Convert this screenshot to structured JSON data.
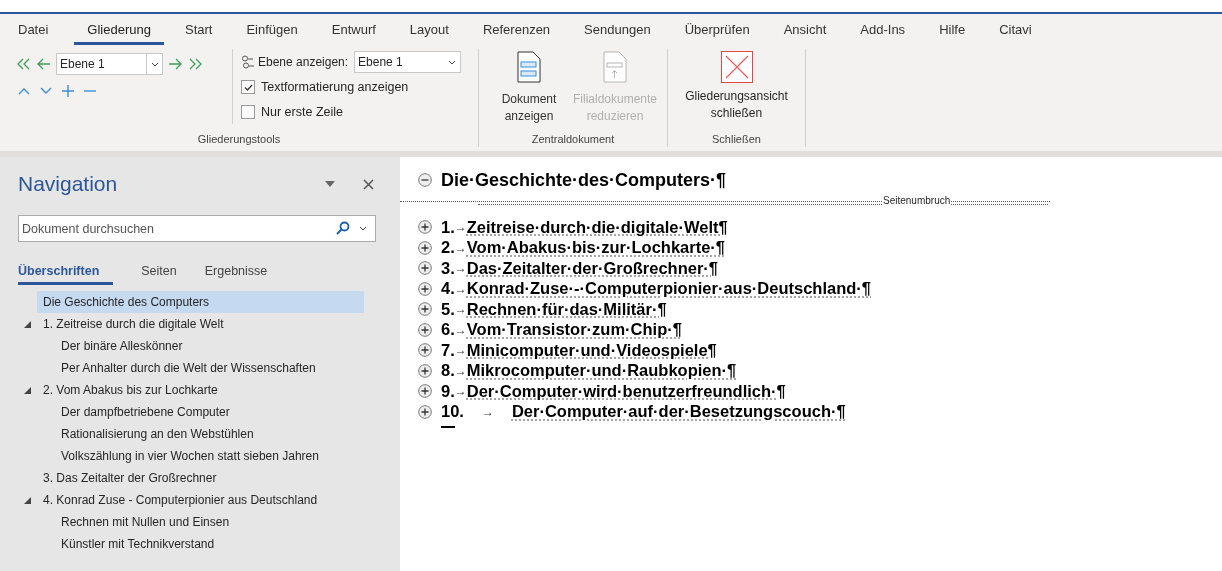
{
  "ribbon_tabs": [
    {
      "label": "Datei",
      "selected": false
    },
    {
      "label": "Gliederung",
      "selected": true
    },
    {
      "label": "Start",
      "selected": false
    },
    {
      "label": "Einfügen",
      "selected": false
    },
    {
      "label": "Entwurf",
      "selected": false
    },
    {
      "label": "Layout",
      "selected": false
    },
    {
      "label": "Referenzen",
      "selected": false
    },
    {
      "label": "Sendungen",
      "selected": false
    },
    {
      "label": "Überprüfen",
      "selected": false
    },
    {
      "label": "Ansicht",
      "selected": false
    },
    {
      "label": "Add-Ins",
      "selected": false
    },
    {
      "label": "Hilfe",
      "selected": false
    },
    {
      "label": "Citavi",
      "selected": false
    }
  ],
  "outline_tools": {
    "level_select": "Ebene 1",
    "show_level_label": "Ebene anzeigen:",
    "show_level_value": "Ebene 1",
    "checkboxes": [
      {
        "label": "Textformatierung anzeigen",
        "checked": true
      },
      {
        "label": "Nur erste Zeile",
        "checked": false
      }
    ],
    "group_label": "Gliederungstools"
  },
  "master_document": {
    "buttons": [
      {
        "label": "Dokument anzeigen",
        "disabled": false
      },
      {
        "label": "Filialdokumente reduzieren",
        "disabled": true
      }
    ],
    "group_label": "Zentraldokument"
  },
  "close_group": {
    "button": "Gliederungsansicht schließen",
    "group_label": "Schließen"
  },
  "navigation": {
    "title": "Navigation",
    "search": {
      "placeholder": "Dokument durchsuchen"
    },
    "tabs": [
      {
        "label": "Überschriften",
        "selected": true
      },
      {
        "label": "Seiten",
        "selected": false
      },
      {
        "label": "Ergebnisse",
        "selected": false
      }
    ],
    "headings": [
      {
        "label": "Die Geschichte des Computers",
        "selected": true
      },
      {
        "label": "1. Zeitreise durch die digitale Welt",
        "selected": false,
        "children": [
          {
            "label": "Der binäre Alleskönner",
            "selected": false
          },
          {
            "label": "Per Anhalter durch die Welt der Wissenschaften",
            "selected": false
          }
        ]
      },
      {
        "label": "2. Vom Abakus bis zur Lochkarte",
        "selected": false,
        "children": [
          {
            "label": "Der dampfbetriebene Computer",
            "selected": false
          },
          {
            "label": "Rationalisierung an den Webstühlen",
            "selected": false
          },
          {
            "label": "Volkszählung in vier Wochen statt sieben Jahren",
            "selected": false
          }
        ]
      },
      {
        "label": "3. Das Zeitalter der Großrechner",
        "selected": false
      },
      {
        "label": "4. Konrad Zuse - Computerpionier aus Deutschland",
        "selected": false,
        "children": [
          {
            "label": "Rechnen mit Nullen und Einsen",
            "selected": false
          },
          {
            "label": "Künstler mit Technikverstand",
            "selected": false
          }
        ]
      }
    ]
  },
  "document": {
    "title": {
      "text": "Die·Geschichte·des·Computers·¶",
      "has_subtext": false
    },
    "page_break_label": "Seitenumbruch",
    "chapters": [
      {
        "number": "1.",
        "tab_mark": "→",
        "text": "Zeitreise·durch·die·digitale·Welt¶",
        "has_subtext": true
      },
      {
        "number": "2.",
        "tab_mark": "→",
        "text": "Vom·Abakus·bis·zur·Lochkarte·¶",
        "has_subtext": true
      },
      {
        "number": "3.",
        "tab_mark": "→",
        "text": "Das·Zeitalter·der·Großrechner·¶",
        "has_subtext": true
      },
      {
        "number": "4.",
        "tab_mark": "→",
        "text": "Konrad·Zuse·-·Computerpionier·aus·Deutschland·¶",
        "has_subtext": true
      },
      {
        "number": "5.",
        "tab_mark": "→",
        "text": "Rechnen·für·das·Militär·¶",
        "has_subtext": true
      },
      {
        "number": "6.",
        "tab_mark": "→",
        "text": "Vom·Transistor·zum·Chip·¶",
        "has_subtext": true
      },
      {
        "number": "7.",
        "tab_mark": "→",
        "text": "Minicomputer·und·Videospiele¶",
        "has_subtext": true
      },
      {
        "number": "8.",
        "tab_mark": "→",
        "text": "Mikrocomputer·und·Raubkopien·¶",
        "has_subtext": true
      },
      {
        "number": "9.",
        "tab_mark": "→",
        "text": "Der·Computer·wird·benutzerfreundlich·¶",
        "has_subtext": true
      },
      {
        "number": "10.",
        "tab_mark": "→",
        "text": "Der·Computer·auf·der·Besetzungscouch·¶",
        "has_subtext": true
      }
    ]
  }
}
